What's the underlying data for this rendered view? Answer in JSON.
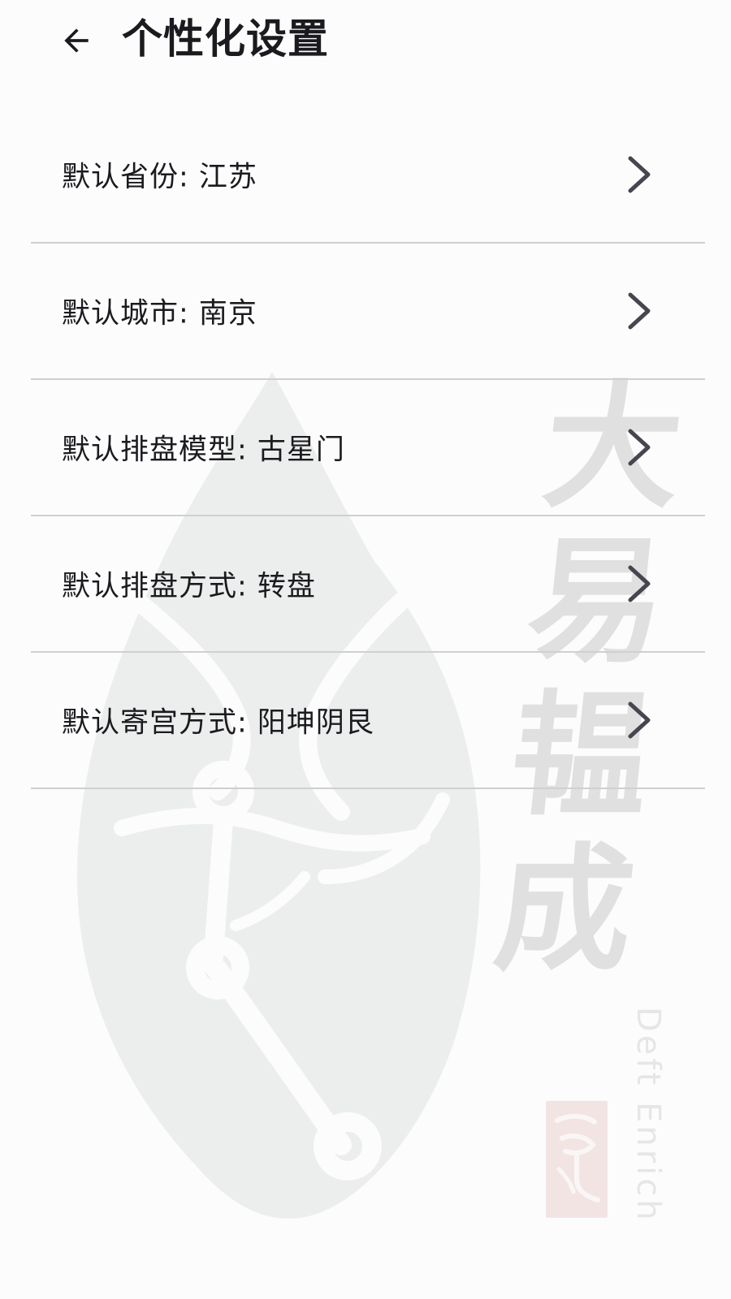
{
  "header": {
    "title": "个性化设置",
    "back_icon": "arrow-left-icon"
  },
  "settings": [
    {
      "label": "默认省份: 江苏",
      "icon": "chevron-right-icon"
    },
    {
      "label": "默认城市: 南京",
      "icon": "chevron-right-icon"
    },
    {
      "label": "默认排盘模型: 古星门",
      "icon": "chevron-right-icon"
    },
    {
      "label": "默认排盘方式: 转盘",
      "icon": "chevron-right-icon"
    },
    {
      "label": "默认寄宫方式: 阳坤阴艮",
      "icon": "chevron-right-icon"
    }
  ],
  "watermark": {
    "calligraphy": [
      "大",
      "易",
      "韫",
      "成"
    ],
    "english": "Deft Enrich"
  },
  "colors": {
    "text": "#1b1b1f",
    "divider": "#cfcfd4",
    "chevron": "#45464f",
    "background": "#fcfcfd",
    "watermark": "#eceeed"
  }
}
